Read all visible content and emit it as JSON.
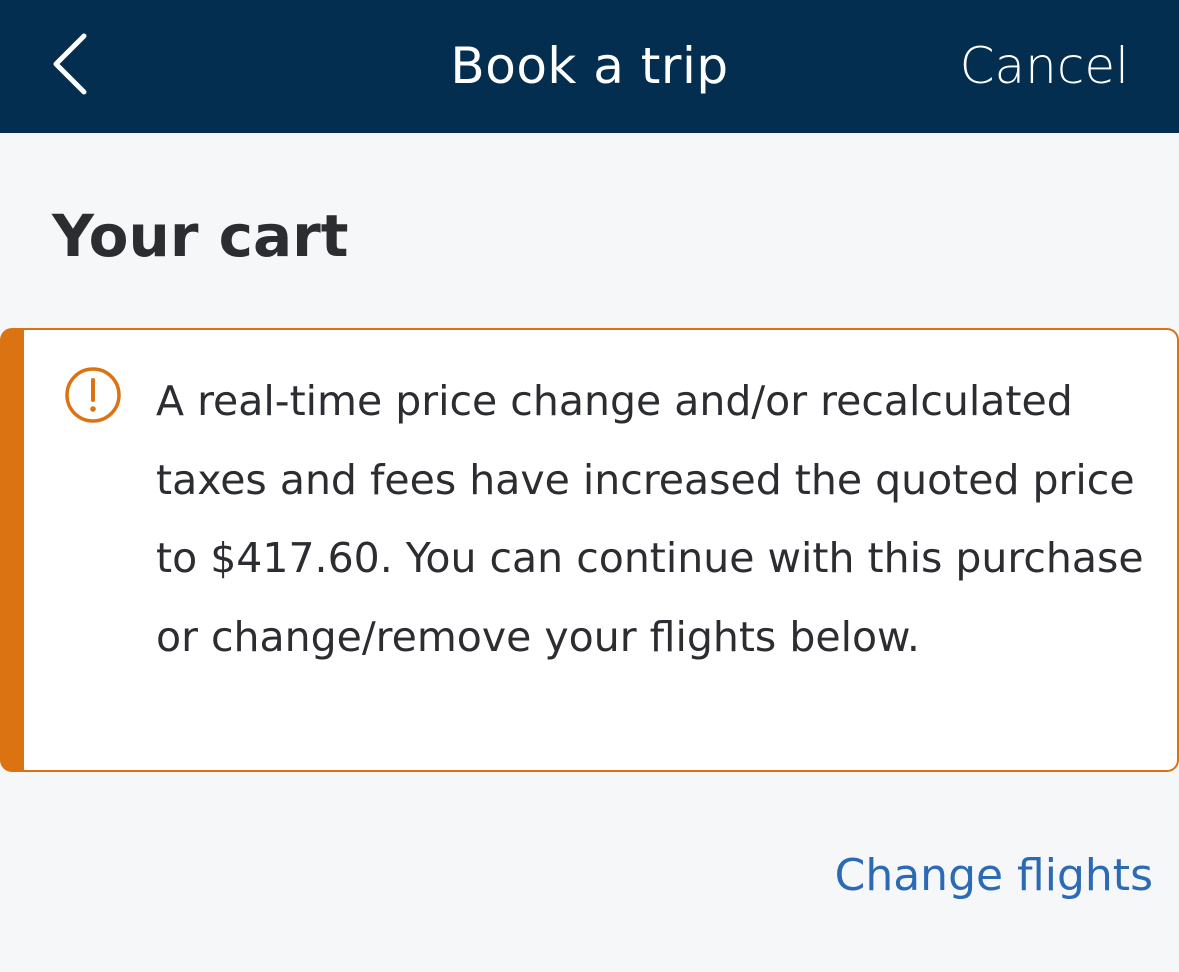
{
  "header": {
    "back_icon": "chevron-left-icon",
    "title": "Book a trip",
    "cancel_label": "Cancel",
    "background_color": "#032e4f"
  },
  "main": {
    "page_title": "Your cart",
    "alert": {
      "icon": "warning-circle-icon",
      "accent_color": "#dc7313",
      "message": "A real-time price change and/or recalculated taxes and fees have increased the quoted price to $417.60. You can continue with this purchase or change/remove your flights below."
    },
    "change_flights_label": "Change flights",
    "link_color": "#2b6ab5"
  }
}
